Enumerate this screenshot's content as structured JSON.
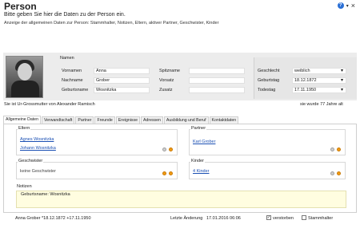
{
  "header": {
    "title": "Person",
    "subtitle": "Bitte geben Sie hier die Daten zu der Person ein.",
    "description": "Anzeige der allgemeinen Daten zur Person: Stammhalter, Notizen, Eltern, aktiver Partner, Geschwister, Kinder"
  },
  "names": {
    "section_label": "Namen",
    "vorname_label": "Vornamen",
    "vorname_value": "Anna",
    "nachname_label": "Nachname",
    "nachname_value": "Grober",
    "geburtsname_label": "Geburtsname",
    "geburtsname_value": "Wosnitzka",
    "spitzname_label": "Spitzname",
    "spitzname_value": "",
    "vorsatz_label": "Vorsatz",
    "vorsatz_value": "",
    "zusatz_label": "Zusatz",
    "zusatz_value": ""
  },
  "details": {
    "geschlecht_label": "Geschlecht",
    "geschlecht_value": "weiblich",
    "geburtstag_label": "Geburtstag",
    "geburtstag_value": "18.12.1872",
    "todestag_label": "Todestag",
    "todestag_value": "17.11.1950"
  },
  "caption": "Sie ist Ur-Grossmutter von Alexander Ramisch",
  "age": "sie wurde 77 Jahre alt",
  "tabs": [
    "Allgemeine Daten",
    "Verwandtschaft",
    "Partner",
    "Freunde",
    "Ereignisse",
    "Adressen",
    "Ausbildung und Beruf",
    "Kontaktdaten"
  ],
  "eltern": {
    "label": "Eltern",
    "items": [
      "Agnes Wosnitzka",
      "Johann Wosnitzka"
    ]
  },
  "partner": {
    "label": "Partner",
    "items": [
      "Karl Grober"
    ]
  },
  "geschwister": {
    "label": "Geschwister",
    "text": "keine Geschwister"
  },
  "kinder": {
    "label": "Kinder",
    "items": [
      "4 Kinder"
    ]
  },
  "notizen": {
    "label": "Notizen",
    "text": "Geburtsname: Wosnitzka"
  },
  "footer": {
    "summary": "Anna Grober  *18.12.1872  +17.11.1950",
    "last_change_label": "Letzte Änderung",
    "last_change_value": "17.01.2016 06:06",
    "verstorben_label": "verstorben",
    "verstorben_checked": true,
    "stammhalter_label": "Stammhalter",
    "stammhalter_checked": false
  },
  "colors": {
    "link": "#1a4fb3",
    "notes_bg": "#fffde0",
    "add_icon": "#f39c12"
  },
  "icons": {
    "help": "help-icon",
    "add": "add-icon",
    "edit": "edit-icon"
  }
}
